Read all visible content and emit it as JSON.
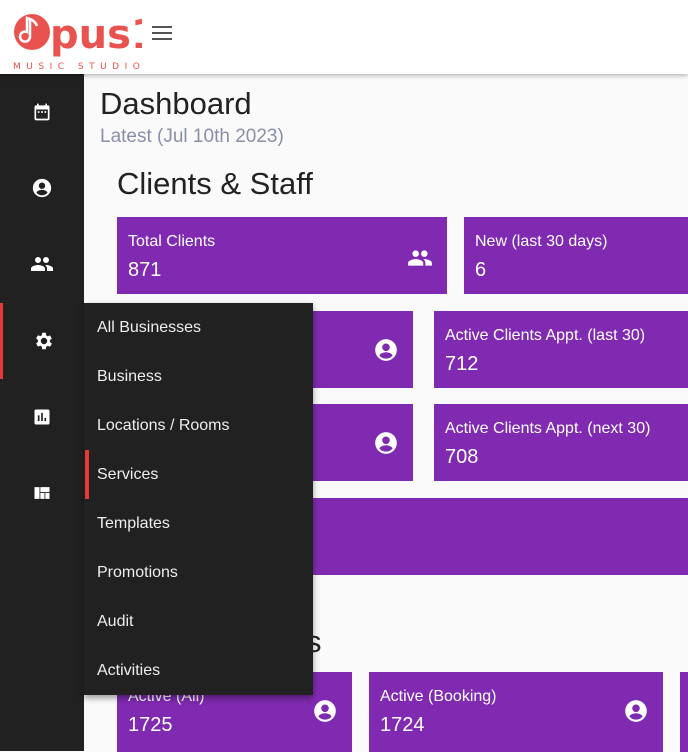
{
  "header": {
    "logo_text": "Opus1",
    "logo_subtitle": "MUSIC STUDIO",
    "brand_color": "#e8534f"
  },
  "sidebar": {
    "items": [
      {
        "icon": "calendar-icon"
      },
      {
        "icon": "account-circle-icon"
      },
      {
        "icon": "people-icon"
      },
      {
        "icon": "gear-icon",
        "active": true
      },
      {
        "icon": "bar-chart-icon"
      },
      {
        "icon": "dashboard-icon"
      }
    ]
  },
  "menu": {
    "items": [
      {
        "label": "All Businesses"
      },
      {
        "label": "Business"
      },
      {
        "label": "Locations / Rooms"
      },
      {
        "label": "Services",
        "active": true
      },
      {
        "label": "Templates"
      },
      {
        "label": "Promotions"
      },
      {
        "label": "Audit"
      },
      {
        "label": "Activities"
      }
    ]
  },
  "main": {
    "title": "Dashboard",
    "subtitle": "Latest (Jul 10th 2023)",
    "section1": "Clients & Staff",
    "section2_visible": "s",
    "cards": [
      {
        "label": "Total Clients",
        "value": "871"
      },
      {
        "label": "New (last 30 days)",
        "value": "6"
      },
      {
        "label": "Active Clients Appt. (last 30)",
        "value": "712"
      },
      {
        "label": "Active Clients Appt. (next 30)",
        "value": "708"
      },
      {
        "label": "Active (All)",
        "value": "1725"
      },
      {
        "label": "Active (Booking)",
        "value": "1724"
      }
    ]
  },
  "colors": {
    "card": "#7f2ab0",
    "sidebar": "#212121",
    "accent": "#e53935"
  }
}
